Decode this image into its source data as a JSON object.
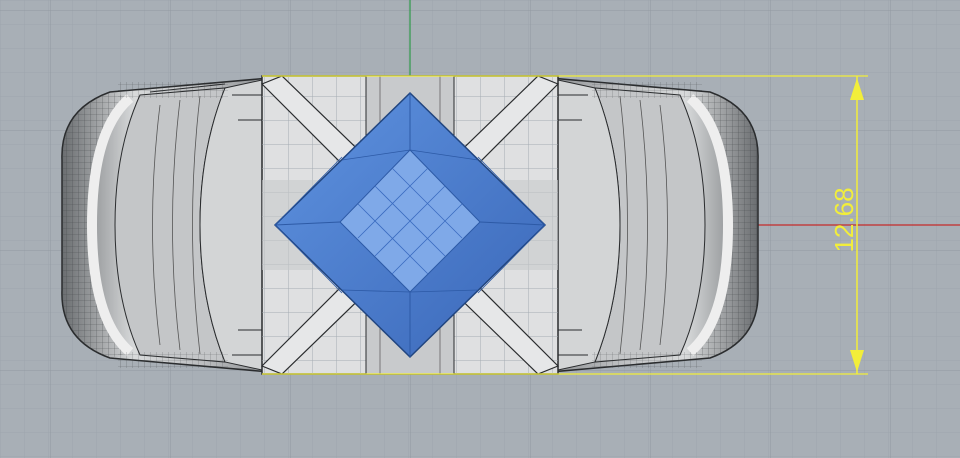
{
  "viewport": {
    "view": "Top",
    "background_color": "#a8afb6",
    "grid_color": "#9aa2a9",
    "x_axis_color": "#c42a2a",
    "y_axis_color": "#2f9a4a"
  },
  "model": {
    "object": "ring-with-square-gemstone",
    "metal_color": "#c9cbcd",
    "gem_color": "#4a7fd0"
  },
  "dimension": {
    "value_text": "12.68",
    "color": "#f2ee3a"
  }
}
